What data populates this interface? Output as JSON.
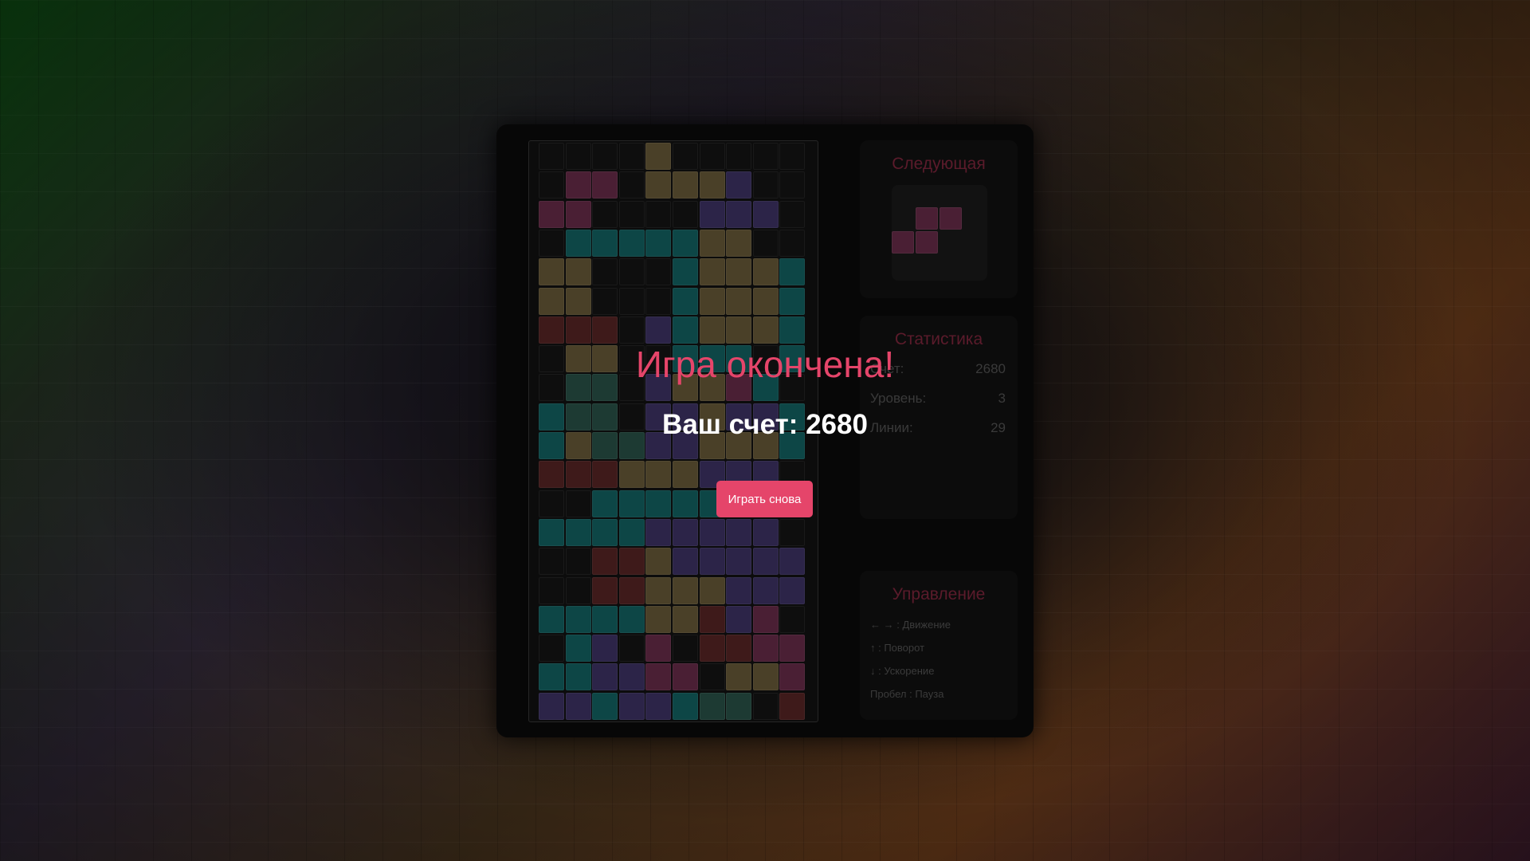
{
  "colors": {
    "accent": "#e5456a",
    "piece_colors": {
      "y": "#4a4028",
      "m": "#4a1f34",
      "b": "#2c2448",
      "t": "#0d4646",
      "r": "#3e1a1a",
      "g": "#1d3a33",
      "e": "#141414"
    }
  },
  "board": {
    "rows": [
      "....y.....",
      ".mm.yyyb..",
      "mm....bbb.",
      ".tttttyy..",
      "yy...tyyyt",
      "yy...tyyyt",
      "rrr.btyyyt",
      ".yy..ttt.t",
      ".gg.byymt.",
      "tgg.bbybbt",
      "tyggbbyyyt",
      "rrryyybbb.",
      "..ttttt...",
      "ttttbbbbb.",
      "..rrybbbbb",
      "..rryyybbb",
      "ttttyyrbm.",
      ".tb.m.rrmm",
      "ttbbmm.yym",
      "bbtbbtgg.r"
    ]
  },
  "next": {
    "title": "Следующая"
  },
  "stats": {
    "title": "Статистика",
    "score_label": "Счет:",
    "score": "2680",
    "level_label": "Уровень:",
    "level": "3",
    "lines_label": "Линии:",
    "lines": "29"
  },
  "controls": {
    "title": "Управление",
    "move": "← → : Движение",
    "rotate": "↑ : Поворот",
    "speed": "↓ : Ускорение",
    "pause": "Пробел : Пауза"
  },
  "overlay": {
    "title": "Игра окончена!",
    "score_text": "Ваш счет: 2680",
    "play_again": "Играть снова"
  }
}
